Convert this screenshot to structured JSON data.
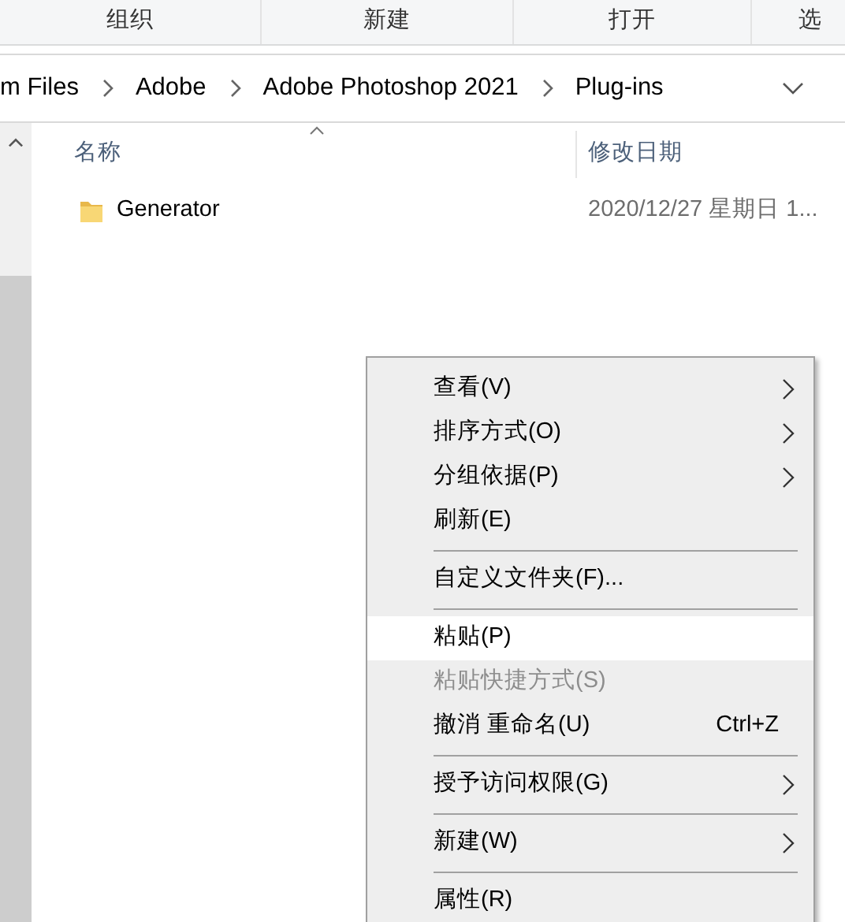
{
  "toolbar": {
    "groups": [
      "组织",
      "新建",
      "打开",
      "选"
    ]
  },
  "address_bar": {
    "segments": [
      "m Files",
      "Adobe",
      "Adobe Photoshop 2021",
      "Plug-ins"
    ]
  },
  "file_list": {
    "columns": [
      {
        "label": "名称",
        "sorted": true
      },
      {
        "label": "修改日期",
        "sorted": false
      }
    ],
    "rows": [
      {
        "name": "Generator",
        "modified": "2020/12/27 星期日 1..."
      }
    ]
  },
  "context_menu": {
    "items": [
      {
        "kind": "item",
        "label": "查看(V)",
        "submenu": true,
        "selected": false,
        "disabled": false
      },
      {
        "kind": "item",
        "label": "排序方式(O)",
        "submenu": true,
        "selected": false,
        "disabled": false
      },
      {
        "kind": "item",
        "label": "分组依据(P)",
        "submenu": true,
        "selected": false,
        "disabled": false
      },
      {
        "kind": "item",
        "label": "刷新(E)",
        "submenu": false,
        "selected": false,
        "disabled": false
      },
      {
        "kind": "separator"
      },
      {
        "kind": "item",
        "label": "自定义文件夹(F)...",
        "submenu": false,
        "selected": false,
        "disabled": false
      },
      {
        "kind": "separator"
      },
      {
        "kind": "item",
        "label": "粘贴(P)",
        "submenu": false,
        "selected": true,
        "disabled": false
      },
      {
        "kind": "item",
        "label": "粘贴快捷方式(S)",
        "submenu": false,
        "selected": false,
        "disabled": true
      },
      {
        "kind": "item",
        "label": "撤消 重命名(U)",
        "shortcut": "Ctrl+Z",
        "submenu": false,
        "selected": false,
        "disabled": false
      },
      {
        "kind": "separator"
      },
      {
        "kind": "item",
        "label": "授予访问权限(G)",
        "submenu": true,
        "selected": false,
        "disabled": false
      },
      {
        "kind": "separator"
      },
      {
        "kind": "item",
        "label": "新建(W)",
        "submenu": true,
        "selected": false,
        "disabled": false
      },
      {
        "kind": "separator"
      },
      {
        "kind": "item",
        "label": "属性(R)",
        "submenu": false,
        "selected": false,
        "disabled": false
      }
    ]
  }
}
